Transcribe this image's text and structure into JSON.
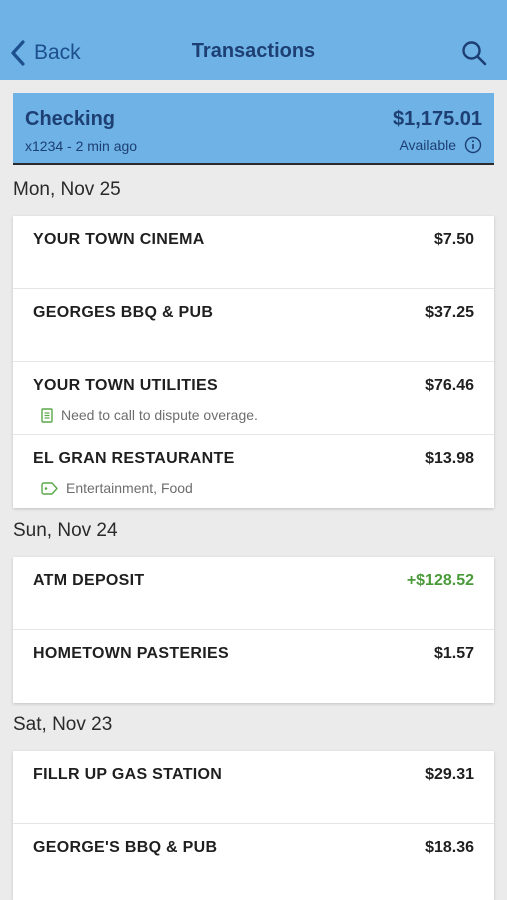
{
  "nav": {
    "back_label": "Back",
    "title": "Transactions"
  },
  "account": {
    "name": "Checking",
    "subtitle": "x1234 - 2 min ago",
    "balance": "$1,175.01",
    "balance_label": "Available"
  },
  "groups": [
    {
      "date": "Mon, Nov 25",
      "transactions": [
        {
          "name": "YOUR TOWN CINEMA",
          "amount": "$7.50"
        },
        {
          "name": "GEORGES BBQ & PUB",
          "amount": "$37.25"
        },
        {
          "name": "YOUR TOWN UTILITIES",
          "amount": "$76.46",
          "note": "Need to call to dispute overage."
        },
        {
          "name": "EL GRAN RESTAURANTE",
          "amount": "$13.98",
          "tags": "Entertainment, Food"
        }
      ]
    },
    {
      "date": "Sun, Nov 24",
      "transactions": [
        {
          "name": "ATM DEPOSIT",
          "amount": "+$128.52"
        },
        {
          "name": "HOMETOWN PASTERIES",
          "amount": "$1.57"
        }
      ]
    },
    {
      "date": "Sat, Nov 23",
      "transactions": [
        {
          "name": "FILLR UP GAS STATION",
          "amount": "$29.31"
        },
        {
          "name": "GEORGE'S BBQ & PUB",
          "amount": "$18.36"
        }
      ]
    }
  ],
  "colors": {
    "header_bg": "#6eb2e6",
    "credit": "#4a9a3a",
    "note_icon": "#5aa84a"
  },
  "icons": {
    "back": "chevron-left-icon",
    "search": "search-icon",
    "info": "info-icon",
    "note": "note-icon",
    "tag": "tag-icon"
  }
}
